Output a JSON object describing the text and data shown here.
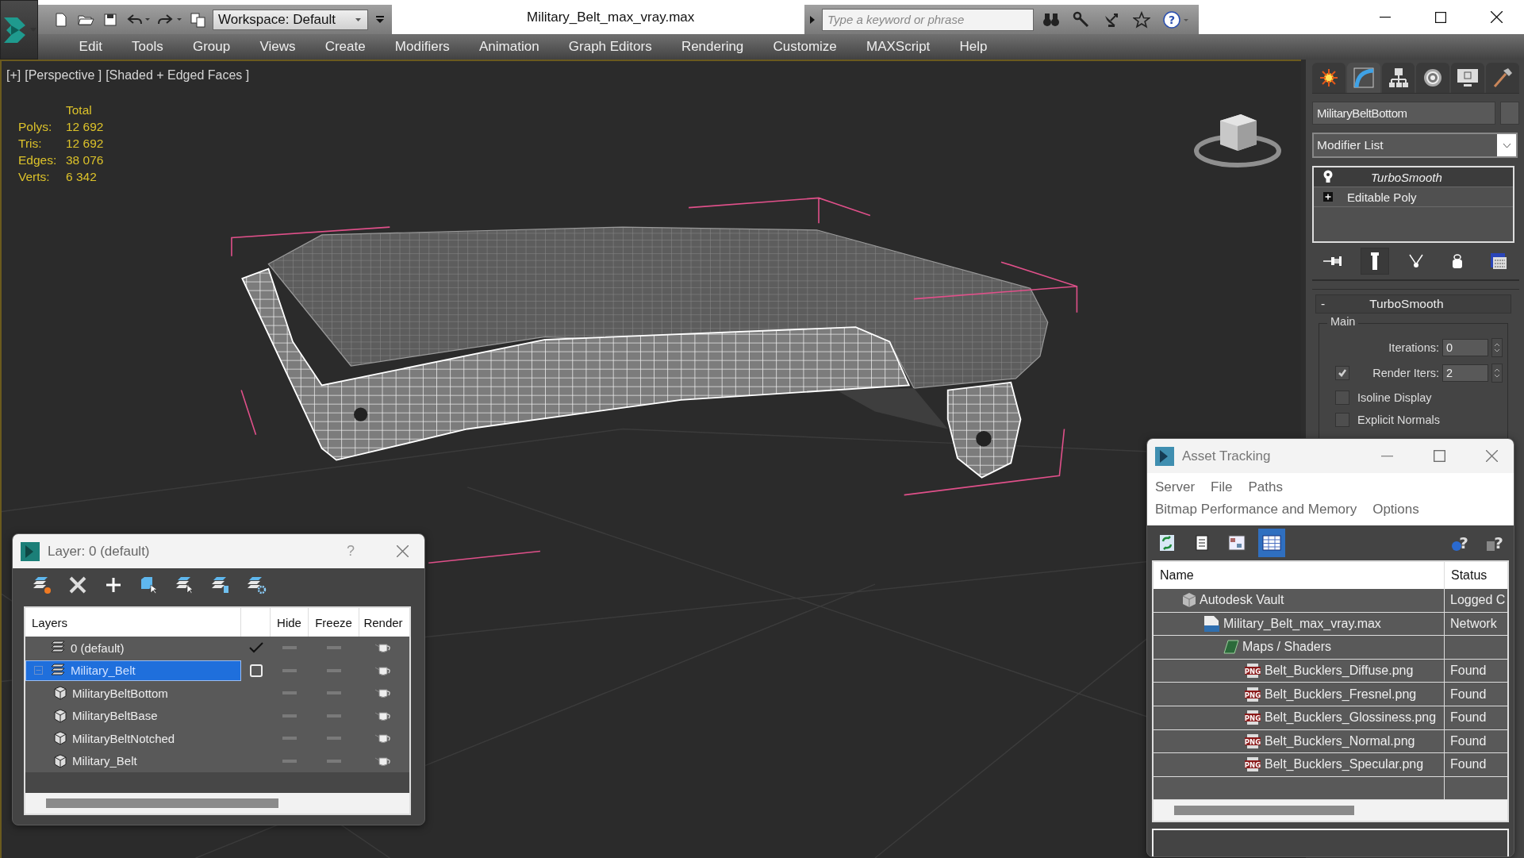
{
  "window": {
    "title": "Military_Belt_max_vray.max"
  },
  "quick_access": {
    "tools": [
      {
        "kind": "new"
      },
      {
        "kind": "open"
      },
      {
        "kind": "save"
      },
      {
        "kind": "undo"
      },
      {
        "kind": "redo"
      },
      {
        "kind": "project"
      }
    ],
    "workspace": "Workspace: Default"
  },
  "search": {
    "placeholder": "Type a keyword or phrase",
    "tools": [
      {
        "kind": "binoculars"
      },
      {
        "kind": "key"
      },
      {
        "kind": "satellite"
      },
      {
        "kind": "star"
      },
      {
        "kind": "help",
        "label": "?"
      }
    ]
  },
  "menu": [
    "Edit",
    "Tools",
    "Group",
    "Views",
    "Create",
    "Modifiers",
    "Animation",
    "Graph Editors",
    "Rendering",
    "Customize",
    "MAXScript",
    "Help"
  ],
  "viewport": {
    "label_parts": [
      "[+]",
      "[Perspective ]",
      "[Shaded + Edged Faces ]"
    ],
    "stats_header": "Total",
    "stats": [
      {
        "label": "Polys:",
        "value": "12 692"
      },
      {
        "label": "Tris:",
        "value": "12 692"
      },
      {
        "label": "Edges:",
        "value": "38 076"
      },
      {
        "label": "Verts:",
        "value": "6 342"
      }
    ]
  },
  "command_panel": {
    "tabs": [
      {
        "kind": "create",
        "selected": false
      },
      {
        "kind": "modify",
        "selected": true
      },
      {
        "kind": "hierarchy",
        "selected": false
      },
      {
        "kind": "motion",
        "selected": false
      },
      {
        "kind": "display",
        "selected": false
      },
      {
        "kind": "utilities",
        "selected": false
      }
    ],
    "object_name": "MilitaryBeltBottom",
    "modifier_list": "Modifier List",
    "stack": [
      {
        "label": "TurboSmooth",
        "kind": "modifier",
        "selected": true
      },
      {
        "label": "Editable Poly",
        "kind": "base",
        "selected": false
      }
    ],
    "stack_tools": [
      {
        "kind": "pin",
        "on": false
      },
      {
        "kind": "end-result",
        "on": true
      },
      {
        "kind": "unique",
        "on": false
      },
      {
        "kind": "remove",
        "on": false
      },
      {
        "kind": "configure",
        "on": false
      }
    ],
    "rollout": {
      "collapse": "-",
      "title": "TurboSmooth",
      "group": "Main",
      "iterations_label": "Iterations:",
      "iterations": "0",
      "render_iters_label": "Render Iters:",
      "render_iters": "2",
      "render_iters_checked": true,
      "options": [
        {
          "label": "Isoline Display",
          "checked": false
        },
        {
          "label": "Explicit Normals",
          "checked": false
        }
      ]
    }
  },
  "layer_dialog": {
    "title": "Layer: 0 (default)",
    "help": "?",
    "tools": [
      {
        "kind": "new-layer"
      },
      {
        "kind": "delete"
      },
      {
        "kind": "add"
      },
      {
        "kind": "select-objects"
      },
      {
        "kind": "select-layer"
      },
      {
        "kind": "set-current"
      },
      {
        "kind": "settings"
      }
    ],
    "columns": [
      "Layers",
      "Hide",
      "Freeze",
      "Render"
    ],
    "layers": [
      {
        "name": "0 (default)",
        "current": true,
        "selected": false
      },
      {
        "name": "Military_Belt",
        "current": false,
        "selected": true,
        "expanded": true,
        "children": [
          {
            "name": "MilitaryBeltBottom",
            "selected": false
          },
          {
            "name": "MilitaryBeltBase",
            "selected": false
          },
          {
            "name": "MilitaryBeltNotched",
            "selected": false
          },
          {
            "name": "Military_Belt",
            "selected": false
          }
        ]
      }
    ]
  },
  "asset_tracking": {
    "title": "Asset Tracking",
    "menu_rows": [
      [
        "Server",
        "File",
        "Paths"
      ],
      [
        "Bitmap Performance and Memory",
        "Options"
      ]
    ],
    "views": [
      {
        "kind": "refresh",
        "selected": false
      },
      {
        "kind": "list",
        "selected": false
      },
      {
        "kind": "thumbnails",
        "selected": false
      },
      {
        "kind": "table",
        "selected": true
      }
    ],
    "help_buttons": [
      {
        "kind": "context-help",
        "label": "?"
      },
      {
        "kind": "help",
        "label": "?"
      }
    ],
    "columns": [
      "Name",
      "Status"
    ],
    "assets": [
      {
        "name": "Autodesk Vault",
        "kind": "vault",
        "status": "Logged C",
        "children": [
          {
            "name": "Military_Belt_max_vray.max",
            "kind": "max",
            "status": "Network",
            "children": [
              {
                "name": "Maps / Shaders",
                "kind": "folder",
                "children": [
                  {
                    "name": "Belt_Bucklers_Diffuse.png",
                    "kind": "png",
                    "icon_text": "PNG",
                    "status": "Found"
                  },
                  {
                    "name": "Belt_Bucklers_Fresnel.png",
                    "kind": "png",
                    "icon_text": "PNG",
                    "status": "Found"
                  },
                  {
                    "name": "Belt_Bucklers_Glossiness.png",
                    "kind": "png",
                    "icon_text": "PNG",
                    "status": "Found"
                  },
                  {
                    "name": "Belt_Bucklers_Normal.png",
                    "kind": "png",
                    "icon_text": "PNG",
                    "status": "Found"
                  },
                  {
                    "name": "Belt_Bucklers_Specular.png",
                    "kind": "png",
                    "icon_text": "PNG",
                    "status": "Found"
                  }
                ]
              }
            ]
          }
        ]
      }
    ]
  }
}
